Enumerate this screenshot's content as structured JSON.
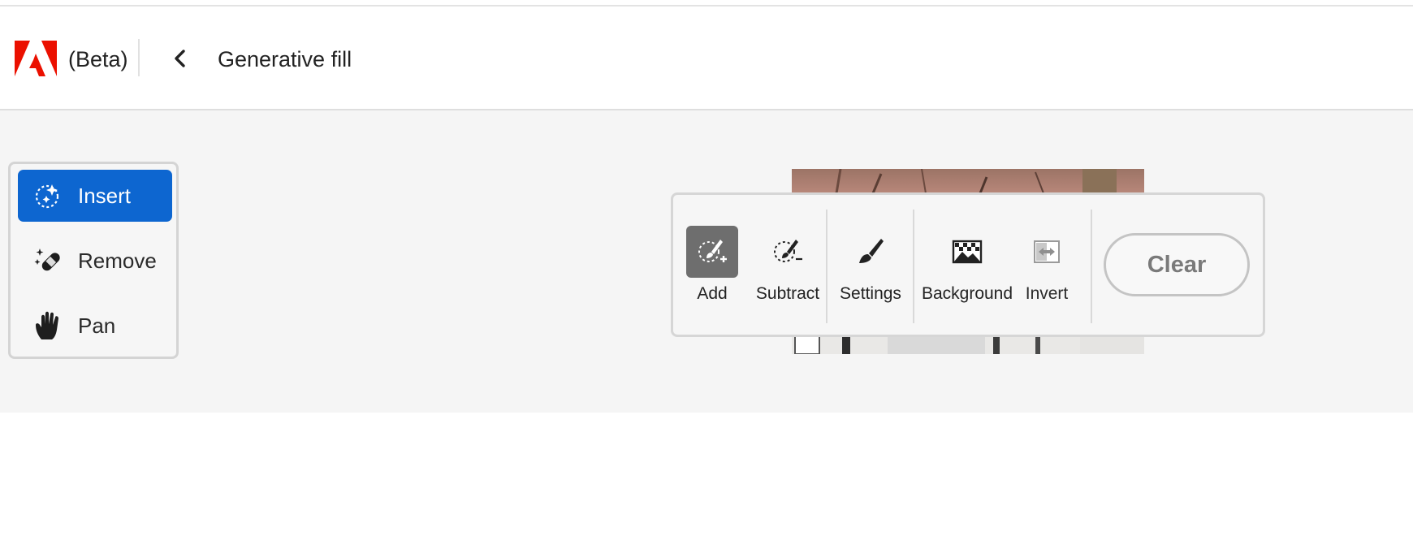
{
  "header": {
    "beta_label": "(Beta)",
    "title": "Generative fill",
    "logo_icon": "adobe-logo",
    "back_icon": "chevron-left-icon",
    "brand_color": "#eb1000"
  },
  "tools": {
    "items": [
      {
        "label": "Insert",
        "icon": "insert-sparkle-icon",
        "active": true
      },
      {
        "label": "Remove",
        "icon": "remove-bandage-icon",
        "active": false
      },
      {
        "label": "Pan",
        "icon": "hand-icon",
        "active": false
      }
    ],
    "active_color": "#0d66d0"
  },
  "toolbar": {
    "add_label": "Add",
    "subtract_label": "Subtract",
    "settings_label": "Settings",
    "background_label": "Background",
    "invert_label": "Invert",
    "clear_label": "Clear",
    "icons": [
      "add-selection-brush-icon",
      "subtract-selection-brush-icon",
      "brush-icon",
      "background-image-icon",
      "invert-icon"
    ]
  }
}
